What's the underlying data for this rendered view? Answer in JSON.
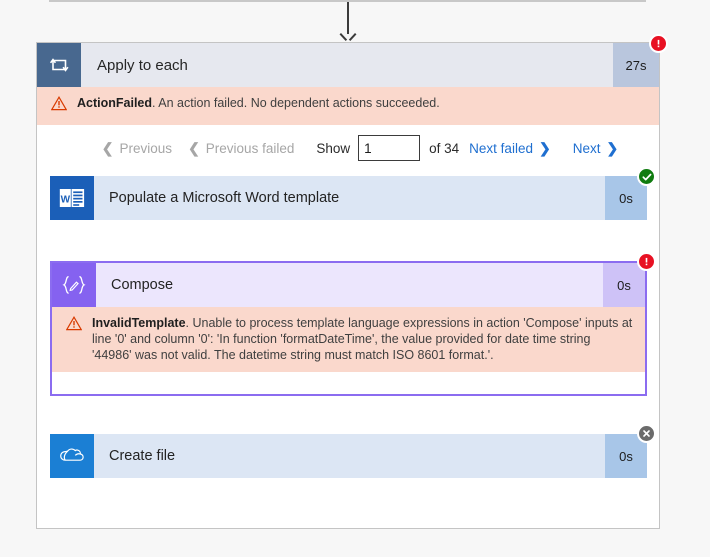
{
  "scope": {
    "title": "Apply to each",
    "icon": "loop-icon",
    "duration": "27s",
    "status": "failed",
    "error": {
      "code": "ActionFailed",
      "message": ". An action failed. No dependent actions succeeded.",
      "icon": "warning-triangle-icon"
    }
  },
  "pagination": {
    "previous_label": "Previous",
    "previous_failed_label": "Previous failed",
    "show_label": "Show",
    "page_value": "1",
    "page_placeholder": "1",
    "of_label": "of 34",
    "next_failed_label": "Next failed",
    "next_label": "Next",
    "total_pages": 34,
    "current_page": 1,
    "prev_enabled": false,
    "next_enabled": true
  },
  "actions": [
    {
      "name": "Populate a Microsoft Word template",
      "icon": "word-document-icon",
      "duration": "0s",
      "status": "succeeded",
      "status_icon": "check-circle-icon"
    },
    {
      "name": "Compose",
      "icon": "compose-braces-icon",
      "duration": "0s",
      "status": "failed",
      "status_icon": "error-circle-icon",
      "selected": true,
      "error": {
        "code": "InvalidTemplate",
        "message": ". Unable to process template language expressions in action 'Compose' inputs at line '0' and column '0': 'In function 'formatDateTime', the value provided for date time string '44986' was not valid. The datetime string must match ISO 8601 format.'.",
        "icon": "warning-triangle-icon"
      }
    },
    {
      "name": "Create file",
      "icon": "onedrive-cloud-icon",
      "duration": "0s",
      "status": "skipped",
      "status_icon": "cancel-circle-icon"
    }
  ],
  "colors": {
    "error_red": "#e81123",
    "success_green": "#107c10",
    "skipped_grey": "#6b6b6b",
    "link_blue": "#1f6fd0",
    "error_banner_bg": "#fad8cc",
    "scope_header_bg": "#e6e8ef",
    "action_card_bg": "#dce6f4",
    "compose_purple": "#8562f0",
    "selection_purple": "#8b6cf0"
  }
}
